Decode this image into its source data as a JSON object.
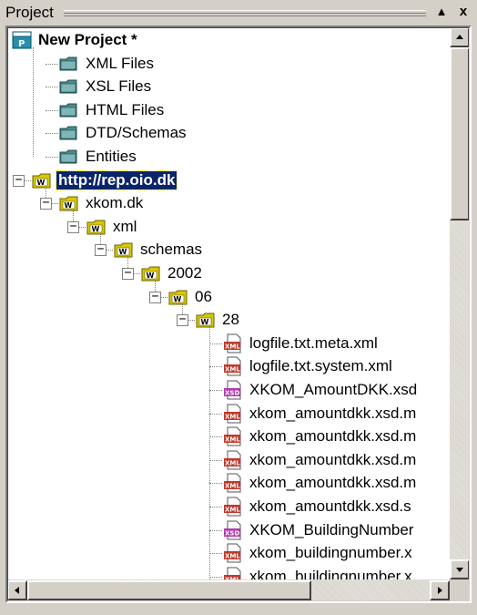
{
  "panel": {
    "title": "Project",
    "buttons": {
      "up": "▲",
      "close": "x"
    }
  },
  "tree": {
    "root": {
      "label": "New Project *",
      "icon": "project-icon"
    },
    "folders": [
      {
        "label": "XML Files",
        "icon": "folder-icon"
      },
      {
        "label": "XSL Files",
        "icon": "folder-icon"
      },
      {
        "label": "HTML Files",
        "icon": "folder-icon"
      },
      {
        "label": "DTD/Schemas",
        "icon": "folder-icon"
      },
      {
        "label": "Entities",
        "icon": "folder-icon"
      }
    ],
    "web_folders": [
      {
        "label": "http://rep.oio.dk",
        "icon": "web-folder-icon",
        "selected": true
      },
      {
        "label": "xkom.dk",
        "icon": "web-folder-icon"
      },
      {
        "label": "xml",
        "icon": "web-folder-icon"
      },
      {
        "label": "schemas",
        "icon": "web-folder-icon"
      },
      {
        "label": "2002",
        "icon": "web-folder-icon"
      },
      {
        "label": "06",
        "icon": "web-folder-icon"
      },
      {
        "label": "28",
        "icon": "web-folder-icon"
      }
    ],
    "files": [
      {
        "label": "logfile.txt.meta.xml",
        "type": "XML"
      },
      {
        "label": "logfile.txt.system.xml",
        "type": "XML"
      },
      {
        "label": "XKOM_AmountDKK.xsd",
        "type": "XSD"
      },
      {
        "label": "xkom_amountdkk.xsd.m",
        "type": "XML"
      },
      {
        "label": "xkom_amountdkk.xsd.m",
        "type": "XML"
      },
      {
        "label": "xkom_amountdkk.xsd.m",
        "type": "XML"
      },
      {
        "label": "xkom_amountdkk.xsd.m",
        "type": "XML"
      },
      {
        "label": "xkom_amountdkk.xsd.s",
        "type": "XML"
      },
      {
        "label": "XKOM_BuildingNumber",
        "type": "XSD"
      },
      {
        "label": "xkom_buildingnumber.x",
        "type": "XML"
      },
      {
        "label": "xkom_buildingnumber.x",
        "type": "XML"
      }
    ]
  },
  "colors": {
    "selection": "#0a246a",
    "xml_badge": "#c0392b",
    "xsd_badge": "#b03ab0",
    "folder": "#4f8a8b",
    "web_folder": "#d8c800"
  },
  "scroll": {
    "vertical_position": 0.0,
    "horizontal_position": 0.0
  }
}
